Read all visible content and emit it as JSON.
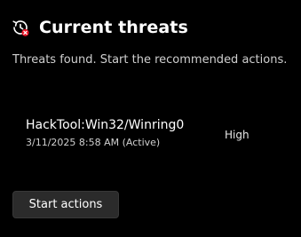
{
  "header": {
    "icon": "threat-history-icon",
    "title": "Current threats"
  },
  "subtitle": "Threats found. Start the recommended actions.",
  "threats": [
    {
      "name": "HackTool:Win32/Winring0",
      "date": "3/11/2025 8:58 AM (Active)",
      "severity": "High"
    }
  ],
  "actions": {
    "start_label": "Start actions"
  },
  "colors": {
    "background": "#000000",
    "alert_dot": "#e81123",
    "button_bg": "#2b2b2b"
  }
}
